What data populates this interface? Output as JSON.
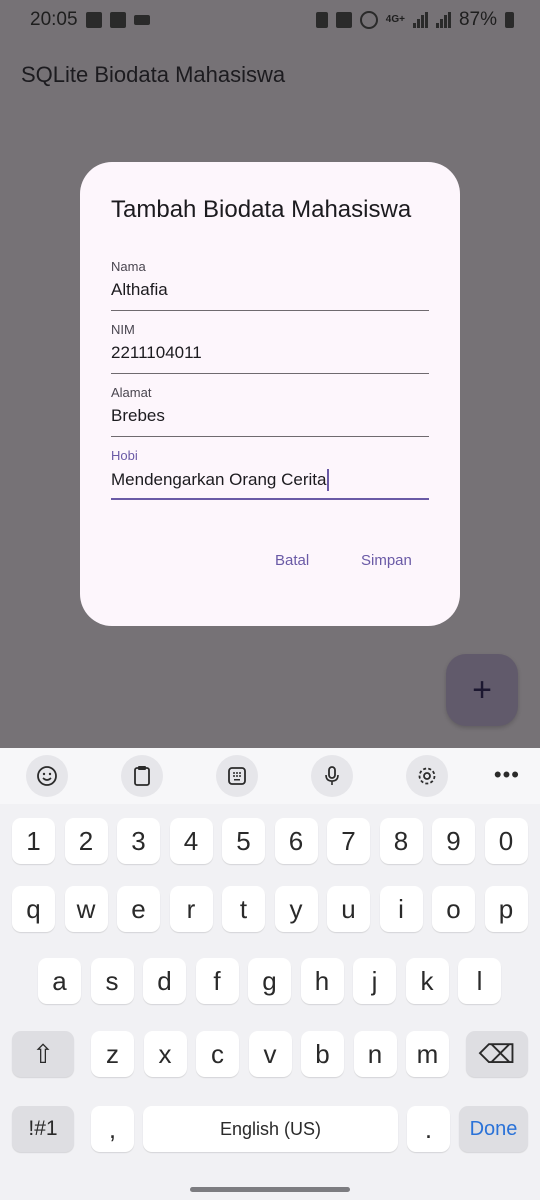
{
  "status": {
    "time": "20:05",
    "network": "4G+",
    "battery": "87%"
  },
  "app": {
    "title": "SQLite Biodata Mahasiswa"
  },
  "dialog": {
    "title": "Tambah Biodata Mahasiswa",
    "fields": [
      {
        "label": "Nama",
        "value": "Althafia"
      },
      {
        "label": "NIM",
        "value": "2211104011"
      },
      {
        "label": "Alamat",
        "value": "Brebes"
      },
      {
        "label": "Hobi",
        "value": "Mendengarkan Orang Cerita"
      }
    ],
    "cancel_label": "Batal",
    "save_label": "Simpan"
  },
  "fab": {
    "icon": "plus-icon",
    "label": "+"
  },
  "keyboard": {
    "toolbar_icons": [
      "emoji-icon",
      "clipboard-icon",
      "keypad-icon",
      "mic-icon",
      "settings-icon",
      "more-icon"
    ],
    "more_label": "•••",
    "row_numbers": [
      "1",
      "2",
      "3",
      "4",
      "5",
      "6",
      "7",
      "8",
      "9",
      "0"
    ],
    "row_top": [
      "q",
      "w",
      "e",
      "r",
      "t",
      "y",
      "u",
      "i",
      "o",
      "p"
    ],
    "row_mid": [
      "a",
      "s",
      "d",
      "f",
      "g",
      "h",
      "j",
      "k",
      "l"
    ],
    "row_bottom": [
      "z",
      "x",
      "c",
      "v",
      "b",
      "n",
      "m"
    ],
    "shift_label": "⇧",
    "backspace_label": "⌫",
    "symbols_label": "!#1",
    "comma_label": ",",
    "space_label": "English (US)",
    "period_label": ".",
    "done_label": "Done",
    "accent_color": "#2a72d8"
  }
}
